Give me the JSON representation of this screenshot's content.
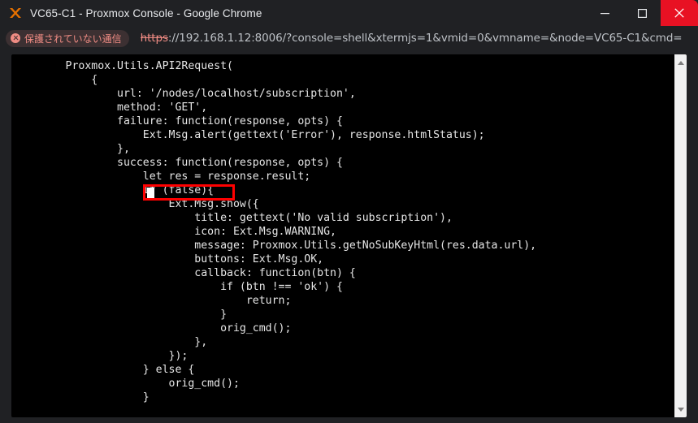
{
  "window": {
    "title": "VC65-C1 - Proxmox Console - Google Chrome",
    "app_icon": "proxmox-x-icon",
    "controls": {
      "minimize_label": "—",
      "maximize_label": "□",
      "close_label": "✕",
      "close_color": "#e81123"
    }
  },
  "address_bar": {
    "security_icon": "not-secure-circle-x-icon",
    "security_label": "保護されていない通信",
    "security_color": "#f08c84",
    "url_scheme": "https",
    "url_rest": "://192.168.1.12:8006/?console=shell&xtermjs=1&vmid=0&vmname=&node=VC65-C1&cmd="
  },
  "terminal": {
    "background": "#000000",
    "foreground": "#e6e6e6",
    "code": "        Proxmox.Utils.API2Request(\n            {\n                url: '/nodes/localhost/subscription',\n                method: 'GET',\n                failure: function(response, opts) {\n                    Ext.Msg.alert(gettext('Error'), response.htmlStatus);\n                },\n                success: function(response, opts) {\n                    let res = response.result;\n                    if (false){\n                        Ext.Msg.show({\n                            title: gettext('No valid subscription'),\n                            icon: Ext.Msg.WARNING,\n                            message: Proxmox.Utils.getNoSubKeyHtml(res.data.url),\n                            buttons: Ext.Msg.OK,\n                            callback: function(btn) {\n                                if (btn !== 'ok') {\n                                    return;\n                                }\n                                orig_cmd();\n                            },\n                        });\n                    } else {\n                        orig_cmd();\n                    }",
    "annotation": {
      "type": "red-rectangle-highlight",
      "target_text": "if (false){",
      "color": "#ff0000"
    },
    "cursor": {
      "shape": "block",
      "color": "#ffffff"
    },
    "scrollbar": {
      "up_arrow": "scroll-up-arrow-icon",
      "down_arrow": "scroll-down-arrow-icon",
      "track_color": "#f1f1f1"
    }
  }
}
